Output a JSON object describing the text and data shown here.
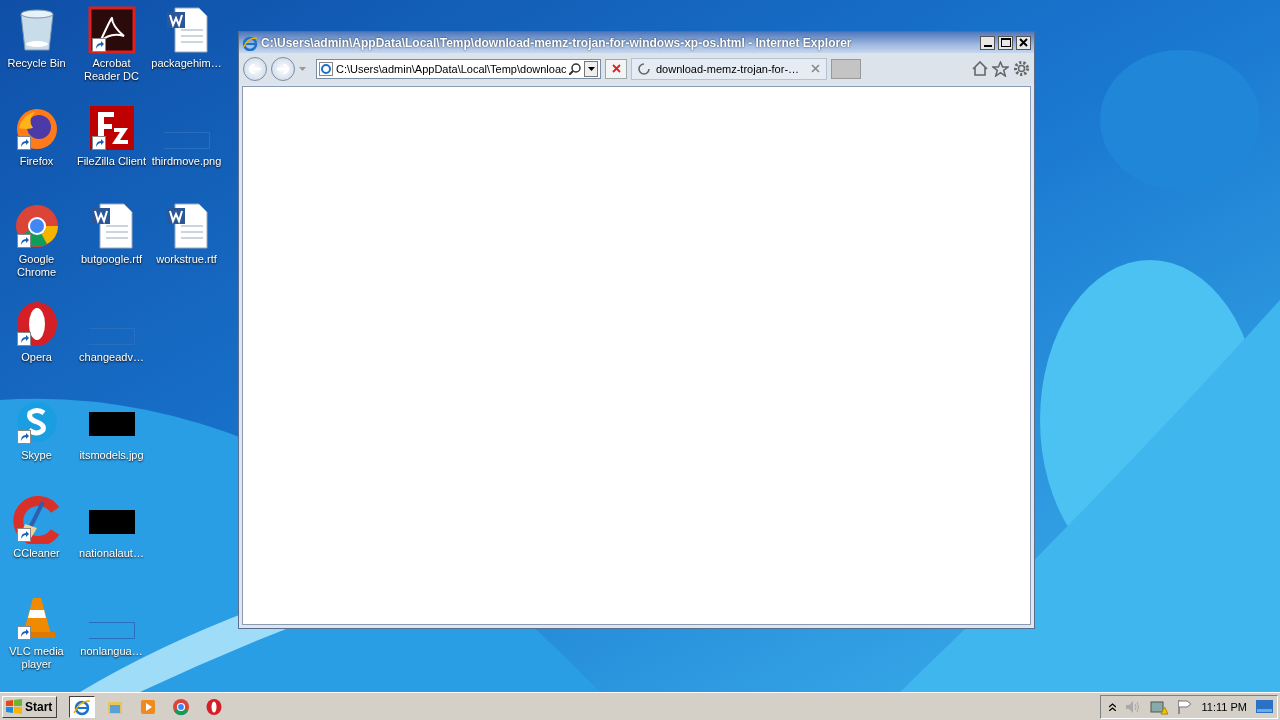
{
  "desktop_icons": [
    {
      "label": "Recycle Bin",
      "kind": "recycle",
      "shortcut": false
    },
    {
      "label": "Firefox",
      "kind": "firefox",
      "shortcut": true
    },
    {
      "label": "Google Chrome",
      "kind": "chrome",
      "shortcut": true
    },
    {
      "label": "Opera",
      "kind": "opera",
      "shortcut": true
    },
    {
      "label": "Skype",
      "kind": "skype",
      "shortcut": true
    },
    {
      "label": "CCleaner",
      "kind": "ccleaner",
      "shortcut": true
    },
    {
      "label": "VLC media player",
      "kind": "vlc",
      "shortcut": true
    },
    {
      "label": "Acrobat Reader DC",
      "kind": "acrobat",
      "shortcut": true
    },
    {
      "label": "FileZilla Client",
      "kind": "filezilla",
      "shortcut": true
    },
    {
      "label": "butgoogle.rtf",
      "kind": "word",
      "shortcut": false
    },
    {
      "label": "changeadv…",
      "kind": "blank",
      "shortcut": false
    },
    {
      "label": "itsmodels.jpg",
      "kind": "dark",
      "shortcut": false
    },
    {
      "label": "nationalaut…",
      "kind": "dark",
      "shortcut": false
    },
    {
      "label": "nonlangua…",
      "kind": "blank",
      "shortcut": false
    },
    {
      "label": "packagehim…",
      "kind": "word",
      "shortcut": false
    },
    {
      "label": "thirdmove.png",
      "kind": "blank",
      "shortcut": false
    },
    {
      "label": "workstrue.rtf",
      "kind": "word",
      "shortcut": false
    }
  ],
  "browser": {
    "title": "C:\\Users\\admin\\AppData\\Local\\Temp\\download-memz-trojan-for-windows-xp-os.html - Internet Explorer",
    "address": "C:\\Users\\admin\\AppData\\Local\\Temp\\downloac",
    "tabs": [
      {
        "label": "download-memz-trojan-for-…",
        "loading": true,
        "selected": true
      }
    ]
  },
  "taskbar": {
    "start_label": "Start",
    "apps": [
      {
        "kind": "ie",
        "selected": true
      },
      {
        "kind": "folder",
        "selected": false
      },
      {
        "kind": "media",
        "selected": false
      },
      {
        "kind": "chrome",
        "selected": false
      },
      {
        "kind": "opera",
        "selected": false
      }
    ],
    "clock": "11:11 PM"
  }
}
